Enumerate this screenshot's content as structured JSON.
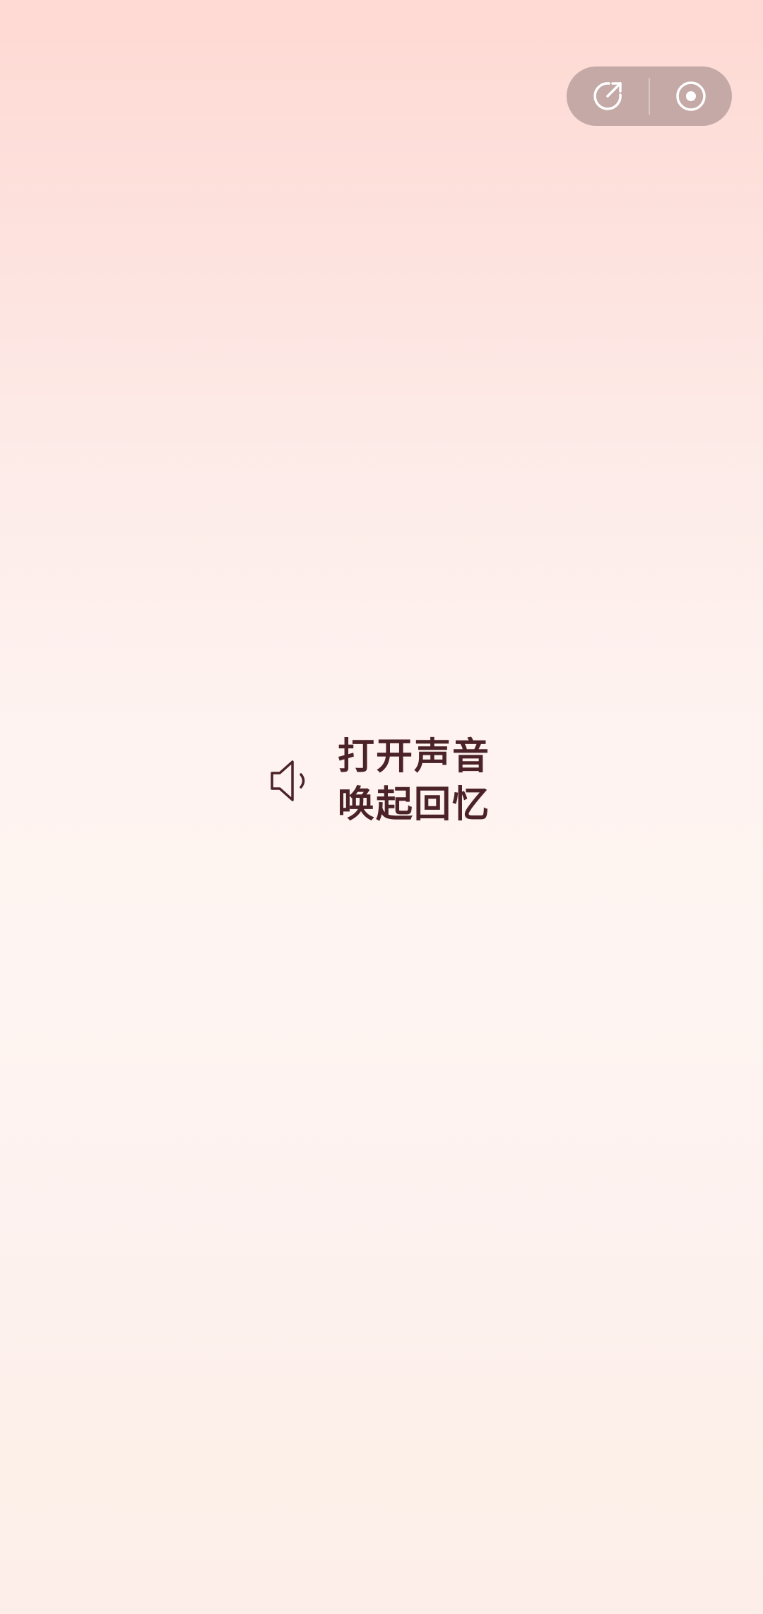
{
  "capsule": {
    "share_icon": "share-arrow-icon",
    "close_icon": "record-dot-icon"
  },
  "prompt": {
    "icon": "speaker-icon",
    "line1": "打开声音",
    "line2": "唤起回忆"
  },
  "colors": {
    "text": "#4a2227",
    "capsule_bg": "#c4a9a6",
    "bg_top": "#ffd9d3",
    "bg_mid": "#fef4f1"
  }
}
